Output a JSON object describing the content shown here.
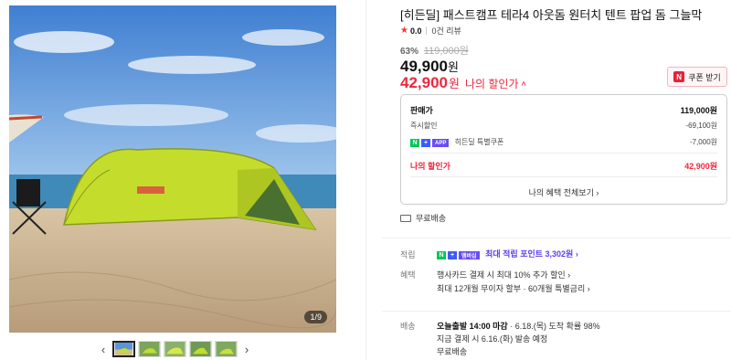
{
  "gallery": {
    "counter": "1/9",
    "prev_icon": "chevron-left-icon",
    "next_icon": "chevron-right-icon",
    "prev_glyph": "‹",
    "next_glyph": "›",
    "thumb_count": 5
  },
  "product": {
    "title": "[히든딜] 패스트캠프 테라4 아웃돔 원터치 텐트 팝업 돔 그늘막",
    "rating": "0.0",
    "reviews": "0건 리뷰",
    "discount_rate": "63%",
    "original_price": "119,000원",
    "price": "49,900",
    "price_unit": "원",
    "my_price": "42,900",
    "my_price_unit": "원",
    "my_price_label": "나의 할인가",
    "my_price_caret": "^"
  },
  "coupon": {
    "label": "쿠폰 받기",
    "icon_text": "N"
  },
  "price_box": {
    "sale_label": "판매가",
    "sale_value": "119,000원",
    "instant_label": "즉시할인",
    "instant_value": "-69,100원",
    "special_label": "히든딜 특별쿠폰",
    "special_value": "-7,000원",
    "special_badge_app": "APP",
    "mine_label": "나의 할인가",
    "mine_value": "42,900원",
    "more_label": "나의 혜택 전체보기 ›"
  },
  "shipping_free": "무료배송",
  "sections": {
    "points_label": "적립",
    "points_badge": "멤버십",
    "points_text": "최대 적립 포인트 3,302원 ›",
    "benefits_label": "혜택",
    "benefits_line1": "행사카드 결제 시 최대 10% 추가 할인 ›",
    "benefits_line2": "최대 12개월 무이자 할부 · 60개월 특별금리 ›",
    "delivery_label": "배송",
    "delivery_bold": "오늘출발 14:00 마감",
    "delivery_rest": "· 6.18.(목) 도착 확률 98%",
    "delivery_line2": "지금 결제 시 6.16.(화) 발송 예정",
    "delivery_line3": "무료배송"
  },
  "colors": {
    "accent_red": "#f0263c",
    "naver_green": "#03c75a",
    "point_purple": "#5b3df5",
    "tent_green": "#c4dd2c"
  }
}
